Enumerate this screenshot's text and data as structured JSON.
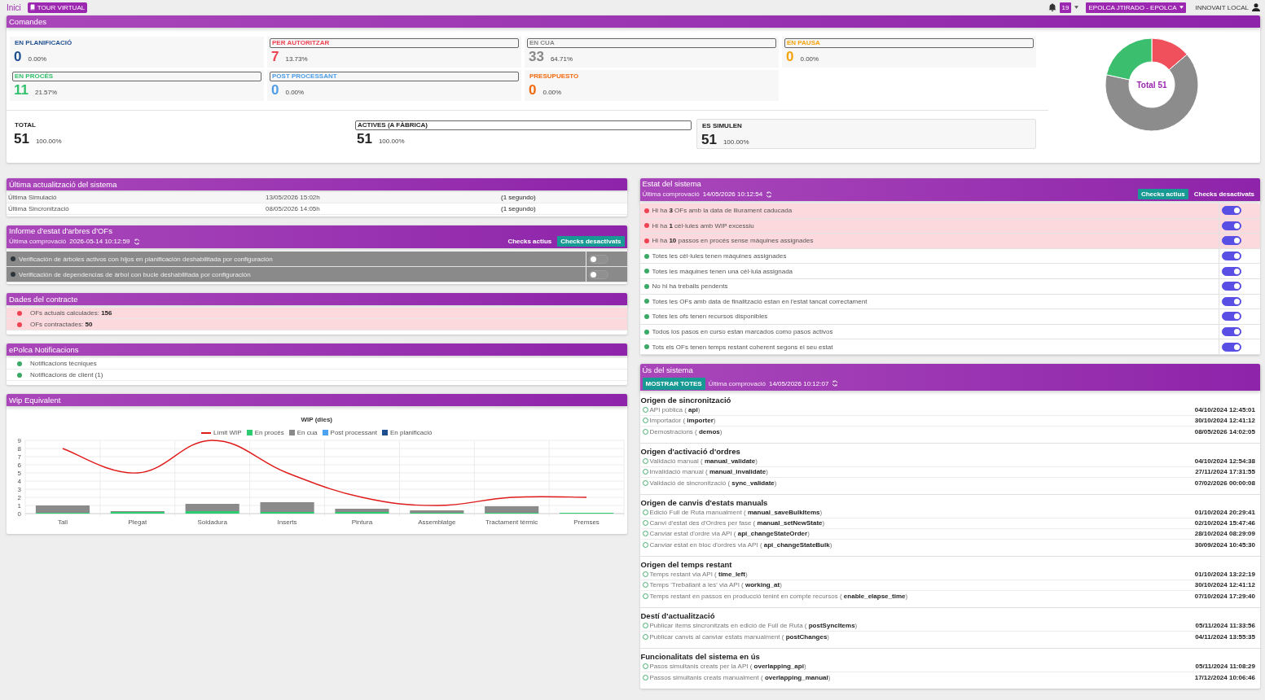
{
  "topbar": {
    "breadcrumb": "Inici",
    "tour_button": "TOUR VIRTUAL",
    "notifications_count": "19",
    "company_menu": "EPOLCA JTIRADO - EPOLCA",
    "user": "INNOVAIT LOCAL"
  },
  "orders": {
    "title": "Comandes",
    "stats": [
      {
        "label": "EN PLANIFICACIÓ",
        "value": "0",
        "percent": "0.00%",
        "color": "#1f4f8f",
        "framed": false
      },
      {
        "label": "PER AUTORITZAR",
        "value": "7",
        "percent": "13.73%",
        "color": "#ee4452",
        "framed": true
      },
      {
        "label": "EN CUA",
        "value": "33",
        "percent": "64.71%",
        "color": "#888888",
        "framed": true
      },
      {
        "label": "EN PAUSA",
        "value": "0",
        "percent": "0.00%",
        "color": "#f4a20a",
        "framed": true
      },
      {
        "label": "EN PROCÉS",
        "value": "11",
        "percent": "21.57%",
        "color": "#33c06d",
        "framed": true
      },
      {
        "label": "POST PROCESSANT",
        "value": "0",
        "percent": "0.00%",
        "color": "#4d9de6",
        "framed": true
      },
      {
        "label": "PRESUPUESTO",
        "value": "0",
        "percent": "0.00%",
        "color": "#f26a0f",
        "framed": false
      }
    ],
    "totals": [
      {
        "label": "TOTAL",
        "value": "51",
        "percent": "100.00%",
        "framed": false,
        "highlighted": false
      },
      {
        "label": "ACTIVES (A FÀBRICA)",
        "value": "51",
        "percent": "100.00%",
        "framed": true,
        "highlighted": false
      },
      {
        "label": "ES SIMULEN",
        "value": "51",
        "percent": "100.00%",
        "framed": false,
        "highlighted": true
      }
    ],
    "chart_data": {
      "type": "donut",
      "title": "Total 51",
      "values": [
        13.73,
        64.71,
        21.57
      ]
    }
  },
  "last_update": {
    "title": "Última actualització del sistema",
    "rows": [
      {
        "label": "Última Simulació",
        "date": "13/05/2026 15:02h",
        "ago": "(1 segundo)"
      },
      {
        "label": "Última Sincronització",
        "date": "08/05/2026 14:05h",
        "ago": "(1 segundo)"
      }
    ]
  },
  "tree_report": {
    "title": "Informe d'estat d'arbres d'OFs",
    "checked_label": "Última comprovació",
    "checked_at": "2026-05-14 10:12:59",
    "filters": [
      {
        "label": "Checks actius",
        "selected": false
      },
      {
        "label": "Checks desactivats",
        "selected": true
      }
    ],
    "checks": [
      {
        "text": "Verificación de árboles activos con hijos en planificación deshabilitada por configuración",
        "on": false
      },
      {
        "text": "Verificación de dependencias de árbol con bucle deshabilitada por configuración",
        "on": false
      }
    ]
  },
  "contract": {
    "title": "Dades del contracte",
    "items": [
      {
        "text": "OFs actuals calculades: **156**"
      },
      {
        "text": "OFs contractades: **50**"
      }
    ]
  },
  "notifications": {
    "title": "ePolca Notificacions",
    "items": [
      {
        "text": "Notificacions tècniques"
      },
      {
        "text": "Notificacions de client (1)"
      }
    ]
  },
  "wip": {
    "title": "Wip Equivalent",
    "chart_data": {
      "type": "bar",
      "title": "WIP (dies)",
      "categories": [
        "Tall",
        "Plegat",
        "Soldadura",
        "Inserts",
        "Pintura",
        "Assemblatge",
        "Tractament tèrmic",
        "Premses"
      ],
      "stacked": true,
      "grid": true,
      "legend": "top",
      "ylim": [
        0,
        9
      ],
      "yticks": [
        0,
        1,
        2,
        3,
        4,
        5,
        6,
        7,
        8,
        9
      ],
      "series": [
        {
          "name": "Límit WIP",
          "type": "line",
          "color": "#e01b1b",
          "values": [
            8,
            5,
            9,
            5,
            2,
            1,
            2,
            2
          ]
        },
        {
          "name": "En procés",
          "color": "#2ecc71",
          "values": [
            0.1,
            0.2,
            0.3,
            0.2,
            0.2,
            0.1,
            0.1,
            0.1
          ]
        },
        {
          "name": "En cua",
          "color": "#8a8a8a",
          "values": [
            0.9,
            0.1,
            0.9,
            1.2,
            0.4,
            0.3,
            0.8,
            0
          ]
        },
        {
          "name": "Post processant",
          "color": "#4ba3f2",
          "values": [
            0,
            0,
            0,
            0,
            0,
            0,
            0,
            0
          ]
        },
        {
          "name": "En planificació",
          "color": "#1f4f8f",
          "values": [
            0,
            0,
            0,
            0,
            0,
            0,
            0,
            0
          ]
        }
      ]
    }
  },
  "system_status": {
    "title": "Estat del sistema",
    "checked_label": "Última comprovació",
    "checked_at": "14/05/2026 10:12:54",
    "filters": [
      {
        "label": "Checks actius",
        "selected": true
      },
      {
        "label": "Checks desactivats",
        "selected": false
      }
    ],
    "checks": [
      {
        "text": "Hi ha **3** OFs amb la data de lliurament caducada",
        "kind": "error",
        "on": true
      },
      {
        "text": "Hi ha **1** cèl·lules amb WIP excessiu",
        "kind": "error",
        "on": true
      },
      {
        "text": "Hi ha **10** passos en procés sense màquines assignades",
        "kind": "error",
        "on": true
      },
      {
        "text": "Totes les cèl·lules tenen màquines assignades",
        "kind": "ok",
        "on": true
      },
      {
        "text": "Totes les màquines tenen una cèl·lula assignada",
        "kind": "ok",
        "on": true
      },
      {
        "text": "No hi ha treballs pendents",
        "kind": "ok",
        "on": true
      },
      {
        "text": "Totes les OFs amb data de finalització estan en l'estat tancat correctament",
        "kind": "ok",
        "on": true
      },
      {
        "text": "Totes les ofs tenen recursos disponibles",
        "kind": "ok",
        "on": true
      },
      {
        "text": "Todos los pasos en curso estan marcados como pasos activos",
        "kind": "ok",
        "on": true
      },
      {
        "text": "Tots els OFs tenen temps restant coherent segons el seu estat",
        "kind": "ok",
        "on": true
      }
    ]
  },
  "usage": {
    "title": "Ús del sistema",
    "show_all": "MOSTRAR TOTES",
    "checked_label": "Última comprovació",
    "checked_at": "14/05/2026 10:12:07",
    "groups": [
      {
        "title": "Origen de sincronització",
        "items": [
          {
            "text": "API pública ( **api**)",
            "date": "04/10/2024 12:45:01"
          },
          {
            "text": "Importador ( **importer**)",
            "date": "30/10/2024 12:41:12"
          },
          {
            "text": "Demostracions ( **demos**)",
            "date": "08/05/2026 14:02:05"
          }
        ]
      },
      {
        "title": "Origen d'activació d'ordres",
        "items": [
          {
            "text": "Validació manual ( **manual_validate**)",
            "date": "04/10/2024 12:54:38"
          },
          {
            "text": "Invalidació manual ( **manual_invalidate**)",
            "date": "27/11/2024 17:31:55"
          },
          {
            "text": "Validació de sincronització ( **sync_validate**)",
            "date": "07/02/2026 00:00:08"
          }
        ]
      },
      {
        "title": "Origen de canvis d'estats manuals",
        "items": [
          {
            "text": "Edició Full de Ruta manualment ( **manual_saveBulkItems**)",
            "date": "01/10/2024 20:29:41"
          },
          {
            "text": "Canvi d'estat des d'Ordres per fase ( **manual_setNewState**)",
            "date": "02/10/2024 15:47:46"
          },
          {
            "text": "Canviar estat d'ordre via API ( **api_changeStateOrder**)",
            "date": "28/10/2024 08:29:09"
          },
          {
            "text": "Canviar estat en bloc d'ordres via API ( **api_changeStateBulk**)",
            "date": "30/09/2024 10:45:30"
          }
        ]
      },
      {
        "title": "Origen del temps restant",
        "items": [
          {
            "text": "Temps restant via API ( **time_left**)",
            "date": "01/10/2024 13:22:19"
          },
          {
            "text": "Temps 'Treballant a les' via API ( **working_at**)",
            "date": "30/10/2024 12:41:12"
          },
          {
            "text": "Temps restant en passos en producció tenint en compte recursos ( **enable_elapse_time**)",
            "date": "07/10/2024 17:29:40"
          }
        ]
      },
      {
        "title": "Destí d'actualització",
        "items": [
          {
            "text": "Publicar ítems sincronitzats en edició de Full de Ruta ( **postSyncItems**)",
            "date": "05/11/2024 11:33:56"
          },
          {
            "text": "Publicar canvis al canviar estats manualment ( **postChanges**)",
            "date": "04/11/2024 13:55:35"
          }
        ]
      },
      {
        "title": "Funcionalitats del sistema en ús",
        "items": [
          {
            "text": "Pasos simultanis creats per la API ( **overlapping_api**)",
            "date": "05/11/2024 11:08:29"
          },
          {
            "text": "Passos simultanis creats manualment ( **overlapping_manual**)",
            "date": "17/12/2024 10:06:46"
          }
        ]
      }
    ]
  }
}
